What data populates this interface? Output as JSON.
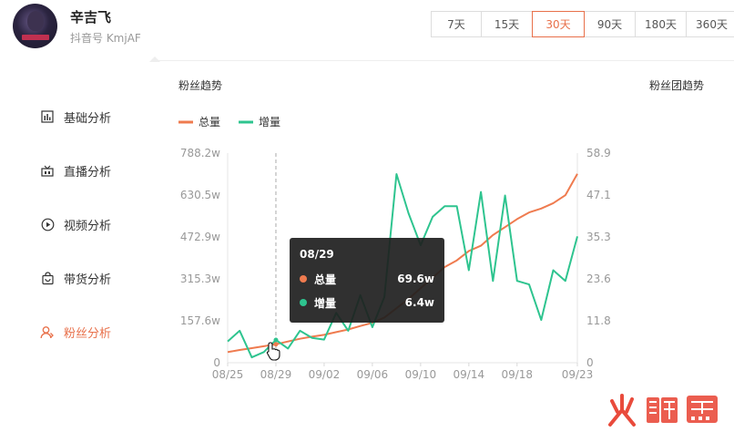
{
  "profile": {
    "name": "辛吉飞",
    "account": "抖音号 KmjAF"
  },
  "ranges": [
    {
      "label": "7天",
      "active": false
    },
    {
      "label": "15天",
      "active": false
    },
    {
      "label": "30天",
      "active": true
    },
    {
      "label": "90天",
      "active": false
    },
    {
      "label": "180天",
      "active": false
    },
    {
      "label": "360天",
      "active": false
    }
  ],
  "sidebar": {
    "items": [
      {
        "label": "基础分析",
        "icon": "bar-chart-icon",
        "active": false
      },
      {
        "label": "直播分析",
        "icon": "broadcast-icon",
        "active": false
      },
      {
        "label": "视频分析",
        "icon": "play-circle-icon",
        "active": false
      },
      {
        "label": "带货分析",
        "icon": "shopping-bag-icon",
        "active": false
      },
      {
        "label": "粉丝分析",
        "icon": "fans-icon",
        "active": true
      }
    ]
  },
  "panel": {
    "title_left": "粉丝趋势",
    "title_right": "粉丝团趋势"
  },
  "colors": {
    "accent": "#e8704a",
    "total": "#ef7b4f",
    "increment": "#2ec48f",
    "axis_text": "#999999"
  },
  "tooltip": {
    "date": "08/29",
    "rows": [
      {
        "label": "总量",
        "value": "69.6w"
      },
      {
        "label": "增量",
        "value": "6.4w"
      }
    ]
  },
  "chart_data": {
    "type": "line",
    "legend": {
      "position": "top-left",
      "entries": [
        "总量",
        "增量"
      ]
    },
    "x": [
      "08/25",
      "08/26",
      "08/27",
      "08/28",
      "08/29",
      "08/30",
      "08/31",
      "09/01",
      "09/02",
      "09/03",
      "09/04",
      "09/05",
      "09/06",
      "09/07",
      "09/08",
      "09/09",
      "09/10",
      "09/11",
      "09/12",
      "09/13",
      "09/14",
      "09/15",
      "09/16",
      "09/17",
      "09/18",
      "09/19",
      "09/20",
      "09/21",
      "09/22",
      "09/23"
    ],
    "x_tick_labels": [
      "08/25",
      "08/29",
      "09/02",
      "09/06",
      "09/10",
      "09/14",
      "09/18",
      "09/23"
    ],
    "y_left": {
      "ticks": [
        "0",
        "157.6w",
        "315.3w",
        "472.9w",
        "630.5w",
        "788.2w"
      ],
      "max": 788.2
    },
    "y_right": {
      "ticks": [
        "0",
        "11.8w",
        "23.6w",
        "35.3w",
        "47.1w",
        "58.9w"
      ],
      "max": 58.9
    },
    "series": [
      {
        "name": "总量",
        "axis": "left",
        "values": [
          40,
          48,
          55,
          62,
          69.6,
          80,
          90,
          98,
          105,
          115,
          125,
          138,
          150,
          170,
          205,
          240,
          280,
          320,
          360,
          385,
          420,
          440,
          480,
          510,
          540,
          565,
          580,
          600,
          630,
          710
        ]
      },
      {
        "name": "增量",
        "axis": "right",
        "values": [
          6,
          9,
          1.5,
          3,
          6.4,
          4,
          9,
          7,
          6.5,
          14,
          9,
          19,
          10,
          18.5,
          53,
          42,
          33,
          41,
          44,
          44,
          26,
          48,
          23,
          47,
          23,
          22,
          12,
          26,
          23,
          35.5
        ]
      }
    ],
    "hover": {
      "index": 4
    }
  }
}
